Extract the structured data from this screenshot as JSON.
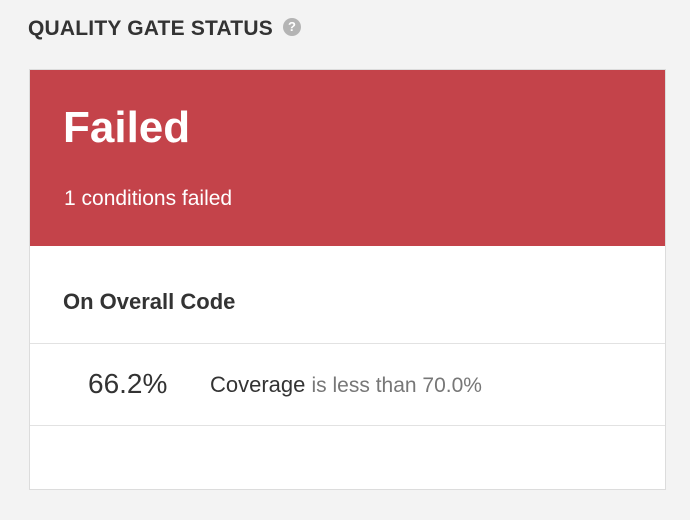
{
  "header": {
    "title": "QUALITY GATE STATUS",
    "help_icon": "question-circle-icon",
    "help_glyph": "?"
  },
  "status": {
    "label": "Failed",
    "summary": "1 conditions failed",
    "color": "#c4434a"
  },
  "section": {
    "title": "On Overall Code"
  },
  "conditions": [
    {
      "value": "66.2%",
      "metric": "Coverage",
      "operator_text": "is less than 70.0%"
    }
  ]
}
